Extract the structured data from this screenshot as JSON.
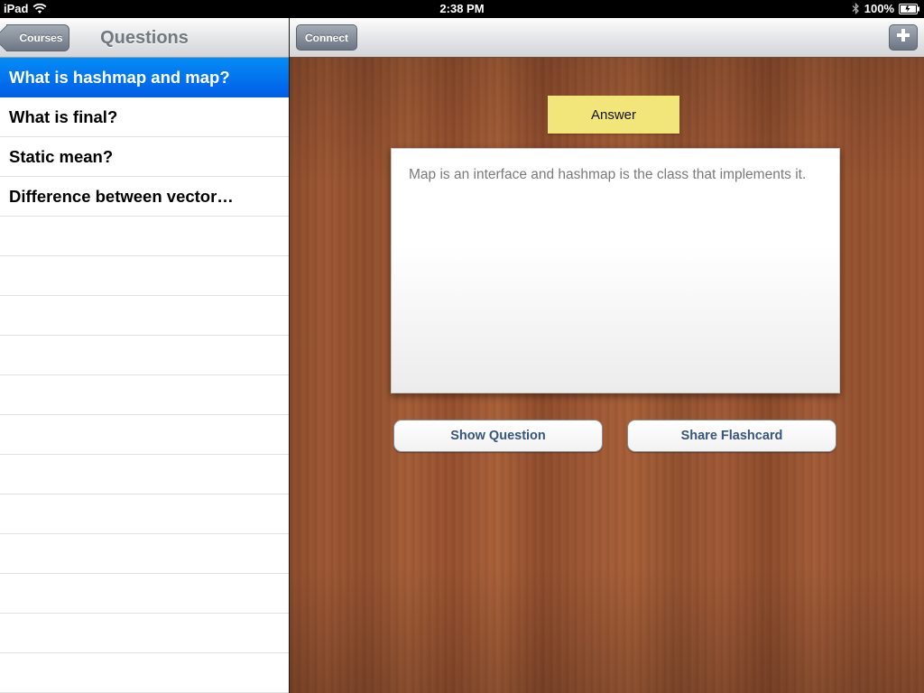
{
  "status_bar": {
    "device": "iPad",
    "time": "2:38 PM",
    "battery": "100%"
  },
  "master": {
    "back_label": "Courses",
    "title": "Questions",
    "questions": [
      {
        "label": "What is hashmap and map?",
        "selected": true
      },
      {
        "label": "What is final?",
        "selected": false
      },
      {
        "label": "Static mean?",
        "selected": false
      },
      {
        "label": "Difference between vector…",
        "selected": false
      }
    ],
    "empty_rows": 11
  },
  "detail": {
    "connect_label": "Connect",
    "add_icon": "plus-icon",
    "tape_label": "Answer",
    "answer_text": "Map is an interface and hashmap is the class that implements it.",
    "show_question_label": "Show Question",
    "share_flashcard_label": "Share Flashcard"
  },
  "colors": {
    "selection": "#015ee6",
    "tape": "#f2e57a",
    "button_text": "#39547e"
  }
}
